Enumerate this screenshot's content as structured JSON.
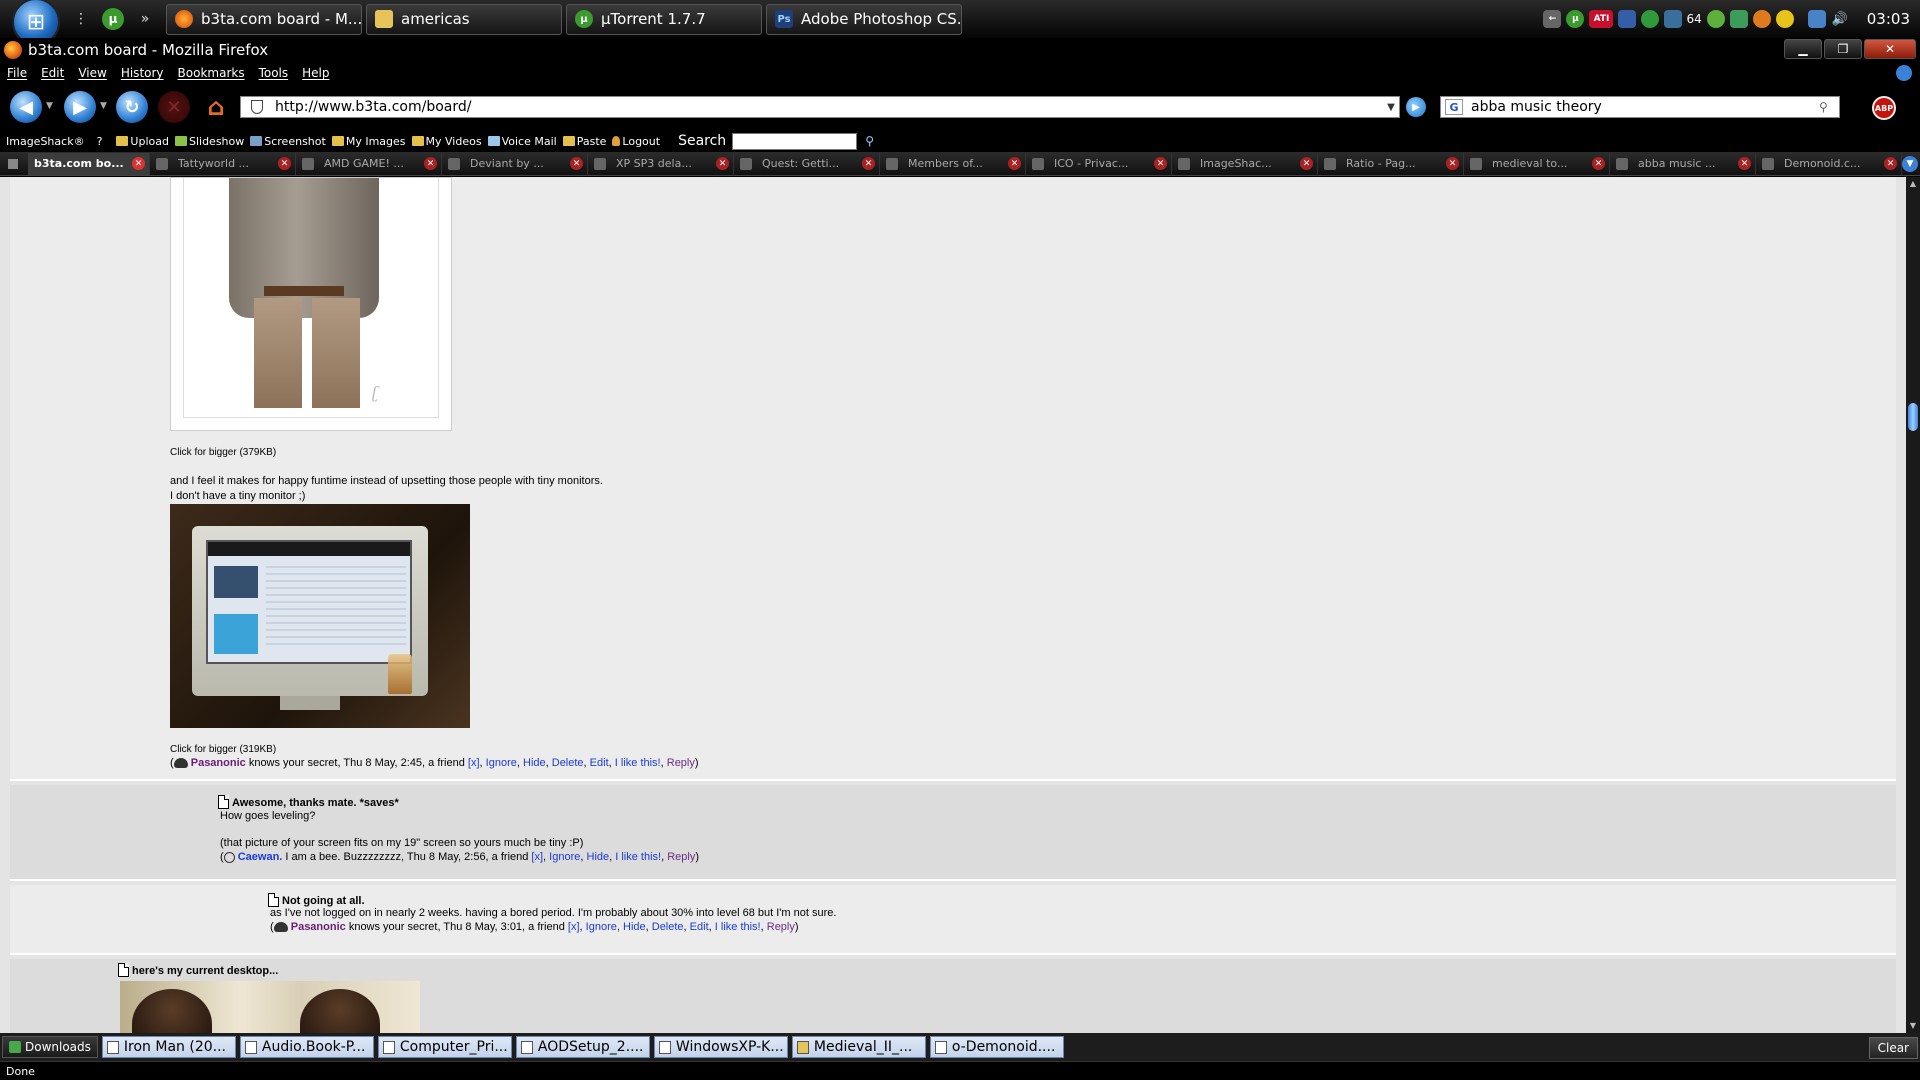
{
  "taskbar": {
    "tasks": [
      {
        "label": "b3ta.com board - M...",
        "icon": "firefox-icon"
      },
      {
        "label": "americas",
        "icon": "folder-icon"
      },
      {
        "label": "µTorrent 1.7.7",
        "icon": "utorrent-icon"
      },
      {
        "label": "Adobe Photoshop CS...",
        "icon": "photoshop-icon"
      }
    ],
    "tray_badge": "64",
    "clock": "03:03"
  },
  "window": {
    "title": "b3ta.com board - Mozilla Firefox"
  },
  "menu": [
    "File",
    "Edit",
    "View",
    "History",
    "Bookmarks",
    "Tools",
    "Help"
  ],
  "nav": {
    "url": "http://www.b3ta.com/board/",
    "search_query": "abba music theory",
    "search_engine": "G",
    "adblock_label": "ABP"
  },
  "imageshack": {
    "brand": "ImageShack®",
    "items": [
      "Upload",
      "Slideshow",
      "Screenshot",
      "My Images",
      "My Videos",
      "Voice Mail",
      "Paste",
      "Logout"
    ],
    "search_label": "Search"
  },
  "tabs": [
    {
      "label": "b3ta.com bo...",
      "active": true
    },
    {
      "label": "Tattyworld ...",
      "active": false
    },
    {
      "label": "AMD GAME! ...",
      "active": false
    },
    {
      "label": "Deviant by ...",
      "active": false
    },
    {
      "label": "XP SP3 dela...",
      "active": false
    },
    {
      "label": "Quest: Getti...",
      "active": false
    },
    {
      "label": "Members of...",
      "active": false
    },
    {
      "label": "ICO - Privac...",
      "active": false
    },
    {
      "label": "ImageShac...",
      "active": false
    },
    {
      "label": "Ratio - Pag...",
      "active": false
    },
    {
      "label": "medieval to...",
      "active": false
    },
    {
      "label": "abba music ...",
      "active": false
    },
    {
      "label": "Demonoid.c...",
      "active": false
    }
  ],
  "posts": {
    "main": {
      "caption1": "Click for bigger (379KB)",
      "line1": "and I feel it makes for happy funtime instead of upsetting those people with tiny monitors.",
      "line2": "I don't have a tiny monitor ;)",
      "caption2": "Click for bigger (319KB)",
      "user": "Pasanonic",
      "meta_text": " knows your secret, Thu 8 May, 2:45, a friend ",
      "friend_x": "[x]"
    },
    "caewan": {
      "title": "Awesome, thanks mate. *saves*",
      "line1": "How goes leveling?",
      "line2": "(that picture of your screen fits on my 19\" screen so yours much be tiny :P)",
      "user": "Caewan.",
      "meta_text": " I am a bee. Buzzzzzzzz, Thu 8 May, 2:56, a friend ",
      "friend_x": "[x]"
    },
    "pasanonic2": {
      "title": "Not going at all.",
      "line1": "as I've not logged on in nearly 2 weeks. having a bored period. I'm probably about 30% into level 68 but I'm not sure.",
      "user": "Pasanonic",
      "meta_text": " knows your secret, Thu 8 May, 3:01, a friend ",
      "friend_x": "[x]"
    },
    "desktop": {
      "title": "here's my current desktop..."
    },
    "actions": {
      "ignore": "Ignore",
      "hide": "Hide",
      "delete": "Delete",
      "edit": "Edit",
      "like": "I like this!",
      "reply": "Reply"
    }
  },
  "downloads": {
    "label": "Downloads",
    "items": [
      "Iron Man (20...",
      "Audio.Book-P...",
      "Computer_Pri...",
      "AODSetup_2....",
      "WindowsXP-K...",
      "Medieval_II_...",
      "o-Demonoid...."
    ],
    "clear": "Clear"
  },
  "status": "Done"
}
